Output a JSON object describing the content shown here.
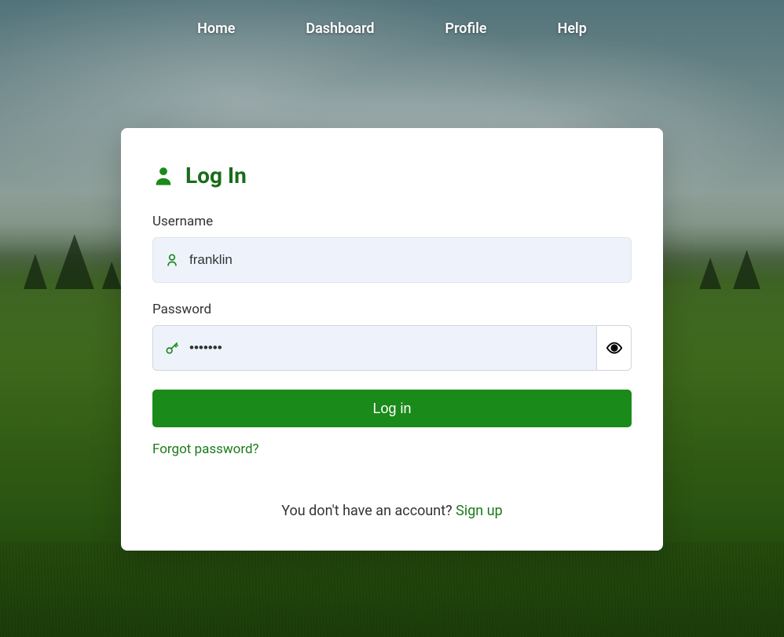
{
  "nav": {
    "items": [
      {
        "label": "Home"
      },
      {
        "label": "Dashboard"
      },
      {
        "label": "Profile"
      },
      {
        "label": "Help"
      }
    ]
  },
  "login": {
    "title": "Log In",
    "username_label": "Username",
    "username_value": "franklin",
    "password_label": "Password",
    "password_value": "•••••••",
    "submit_label": "Log in",
    "forgot_label": "Forgot password?",
    "signup_prompt": "You don't have an account? ",
    "signup_link": "Sign up"
  },
  "colors": {
    "accent": "#1a8a1a",
    "accent_dark": "#1a6b1a"
  }
}
